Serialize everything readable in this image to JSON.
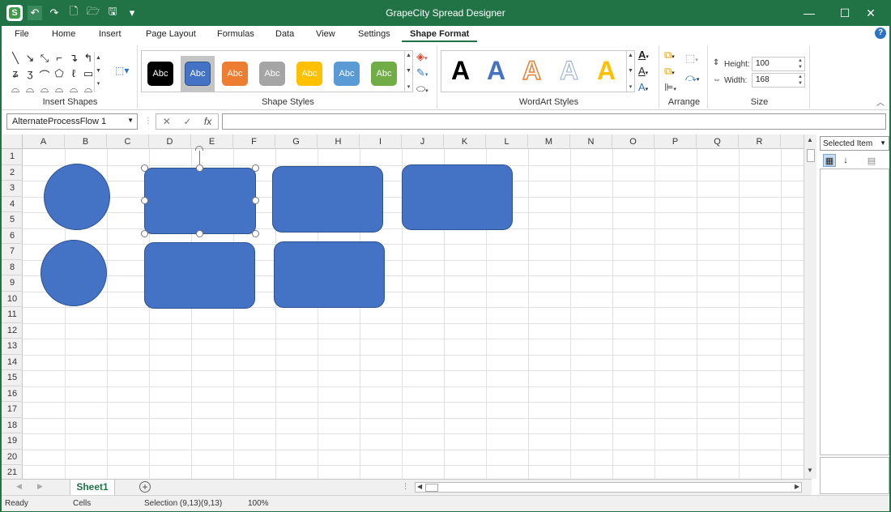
{
  "app": {
    "title": "GrapeCity Spread Designer",
    "logo_letter": "S"
  },
  "window_controls": {
    "minimize": "—",
    "maximize": "☐",
    "close": "✕"
  },
  "quick_access": [
    "undo-icon",
    "redo-icon",
    "new-file-icon",
    "open-folder-icon",
    "save-icon",
    "customize-icon"
  ],
  "tabs": [
    {
      "label": "File"
    },
    {
      "label": "Home"
    },
    {
      "label": "Insert"
    },
    {
      "label": "Page Layout"
    },
    {
      "label": "Formulas"
    },
    {
      "label": "Data"
    },
    {
      "label": "View"
    },
    {
      "label": "Settings"
    },
    {
      "label": "Shape Format",
      "active": true
    }
  ],
  "help_label": "?",
  "ribbon": {
    "insert_shapes_label": "Insert Shapes",
    "shape_styles_label": "Shape Styles",
    "wordart_styles_label": "WordArt Styles",
    "arrange_label": "Arrange",
    "size_label": "Size",
    "style_text": "Abc",
    "style_colors": [
      "#000000",
      "#4472c4",
      "#ed7d31",
      "#a5a5a5",
      "#ffc000",
      "#5b9bd5",
      "#70ad47"
    ],
    "wordart_letter": "A",
    "height_label": "Height:",
    "height_value": "100",
    "width_label": "Width:",
    "width_value": "168"
  },
  "formula_bar": {
    "name_box": "AlternateProcessFlow 1",
    "cancel_icon": "✕",
    "enter_icon": "✓",
    "fx_label": "fx",
    "formula": ""
  },
  "grid": {
    "columns": [
      "A",
      "B",
      "C",
      "D",
      "E",
      "F",
      "G",
      "H",
      "I",
      "J",
      "K",
      "L",
      "M",
      "N",
      "O",
      "P",
      "Q",
      "R"
    ],
    "rows": [
      "1",
      "2",
      "3",
      "4",
      "5",
      "6",
      "7",
      "8",
      "9",
      "10",
      "11",
      "12",
      "13",
      "14",
      "15",
      "16",
      "17",
      "18",
      "19",
      "20",
      "21"
    ],
    "shape_fill": "#4472c4"
  },
  "panel": {
    "dropdown": "Selected Item"
  },
  "sheet_tabs": {
    "active": "Sheet1",
    "add": "+"
  },
  "status": {
    "mode": "Ready",
    "cells": "Cells",
    "selection": "Selection (9,13)(9,13)",
    "zoom": "100%"
  }
}
